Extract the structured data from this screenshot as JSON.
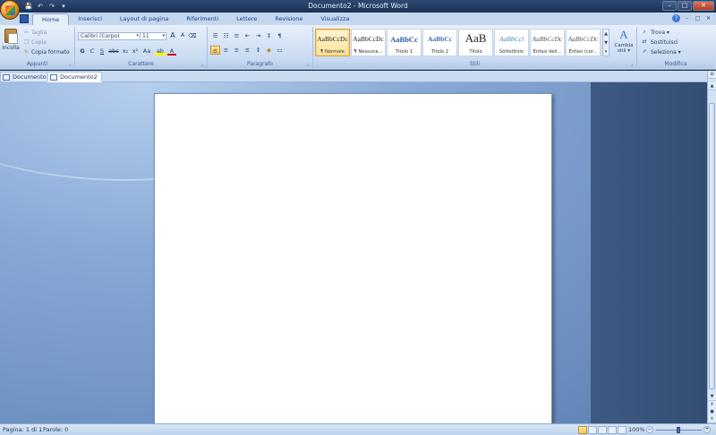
{
  "window": {
    "title": "Documento2 - Microsoft Word",
    "minimize": "–",
    "maximize": "□",
    "close": "✕"
  },
  "qat": {
    "save": "💾",
    "undo": "↶",
    "redo": "↷",
    "customize": "▾"
  },
  "ribbon_tabs": [
    {
      "label": "Home"
    },
    {
      "label": "Inserisci"
    },
    {
      "label": "Layout di pagina"
    },
    {
      "label": "Riferimenti"
    },
    {
      "label": "Lettere"
    },
    {
      "label": "Revisione"
    },
    {
      "label": "Visualizza"
    }
  ],
  "help": {
    "restore": "–",
    "restore2": "□",
    "close": "✕",
    "help": "?"
  },
  "clipboard": {
    "paste": "Incolla",
    "cut": "Taglia",
    "copy": "Copia",
    "format_painter": "Copia formato",
    "label": "Appunti"
  },
  "font": {
    "family": "Calibri (Corpo)",
    "size": "11",
    "grow": "A",
    "shrink": "A",
    "clear": "⌫",
    "bold": "G",
    "italic": "C",
    "underline": "S",
    "strike": "abc",
    "subscript": "x₂",
    "superscript": "x²",
    "case": "Aa",
    "highlight": "ab",
    "color": "A",
    "label": "Carattere"
  },
  "paragraph": {
    "bullets": "☰",
    "numbering": "☷",
    "multilevel": "≡",
    "decrease_indent": "⇤",
    "increase_indent": "⇥",
    "sort": "↕",
    "show_marks": "¶",
    "align_left": "≡",
    "center": "≡",
    "align_right": "≡",
    "justify": "≡",
    "line_spacing": "↕",
    "shading": "◆",
    "borders": "▭",
    "label": "Paragrafo"
  },
  "styles": {
    "items": [
      {
        "sample": "AaBbCcDc",
        "name": "¶ Normale"
      },
      {
        "sample": "AaBbCcDc",
        "name": "¶ Nessuna..."
      },
      {
        "sample": "AaBbCc",
        "name": "Titolo 1"
      },
      {
        "sample": "AaBbCc",
        "name": "Titolo 2"
      },
      {
        "sample": "AaB",
        "name": "Titolo"
      },
      {
        "sample": "AaBbCcl",
        "name": "Sottotitolo"
      },
      {
        "sample": "AaBbCcDc",
        "name": "Enfasi deli..."
      },
      {
        "sample": "AaBbCcDc",
        "name": "Enfasi (cor..."
      }
    ],
    "scroll_up": "▲",
    "scroll_down": "▼",
    "more": "▾",
    "change_icon": "A",
    "change_label_1": "Cambia",
    "change_label_2": "stili ▾",
    "label": "Stili"
  },
  "editing": {
    "find": "Trova ▾",
    "replace": "Sostituisci",
    "select": "Seleziona ▾",
    "label": "Modifica"
  },
  "documents": [
    {
      "label": "Documento1"
    },
    {
      "label": "Documento2"
    }
  ],
  "scrollbar": {
    "up": "▲",
    "ruler": "⊞",
    "down": "▼",
    "prev": "⇞",
    "browse": "●",
    "next": "⇟"
  },
  "status": {
    "page": "Pagina: 1 di 1",
    "words": "Parole: 0",
    "zoom": "100%",
    "zoom_minus": "−",
    "zoom_plus": "+"
  }
}
